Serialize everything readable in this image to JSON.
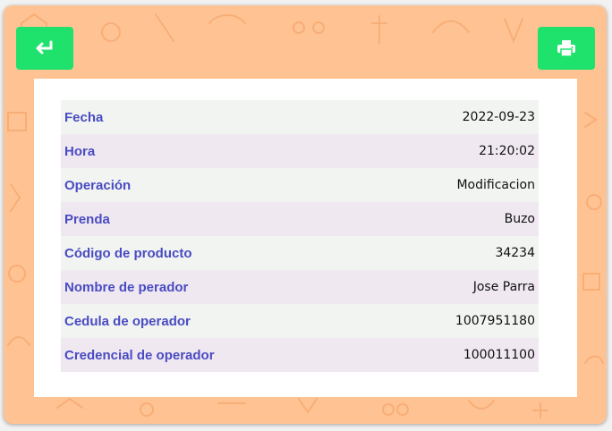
{
  "toolbar": {
    "back_icon": "return-arrow-icon",
    "print_icon": "printer-icon",
    "accent_color": "#1fe26d"
  },
  "details": [
    {
      "label": "Fecha",
      "value": "2022-09-23"
    },
    {
      "label": "Hora",
      "value": "21:20:02"
    },
    {
      "label": "Operación",
      "value": "Modificacion"
    },
    {
      "label": "Prenda",
      "value": "Buzo"
    },
    {
      "label": "Código de producto",
      "value": "34234"
    },
    {
      "label": "Nombre de perador",
      "value": "Jose Parra"
    },
    {
      "label": "Cedula de operador",
      "value": "1007951180"
    },
    {
      "label": "Credencial de operador",
      "value": "100011100"
    }
  ]
}
